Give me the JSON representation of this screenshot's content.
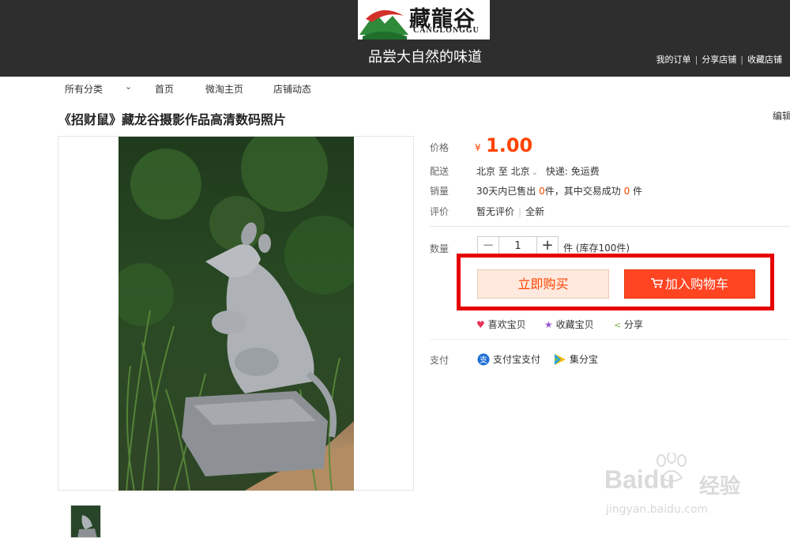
{
  "header": {
    "logo_cn": "藏龍谷",
    "logo_en": "CANGLONGGU",
    "slogan": "品尝大自然的味道",
    "links": [
      "我的订单",
      "分享店铺",
      "收藏店铺"
    ]
  },
  "nav": {
    "items": [
      "所有分类",
      "首页",
      "微淘主页",
      "店铺动态"
    ]
  },
  "product": {
    "title": "《招财鼠》藏龙谷摄影作品高清数码照片",
    "edit": "编辑"
  },
  "details": {
    "price_label": "价格",
    "currency": "¥",
    "price": "1.00",
    "ship_label": "配送",
    "ship_from": "北京 至",
    "ship_to": "北京",
    "express": "快递: 免运费",
    "sales_label": "销量",
    "sales_a": "30天内已售出",
    "sales_count": "0",
    "sales_b": "件，其中交易成功",
    "success_count": "0",
    "sales_c": "件",
    "review_label": "评价",
    "review_text": "暂无评价",
    "condition": "全新",
    "qty_label": "数量",
    "qty_value": "1",
    "minus": "−",
    "plus": "+",
    "stock": "件 (库存100件)",
    "buy_now": "立即购买",
    "add_cart": "加入购物车",
    "like": "喜欢宝贝",
    "favorite": "收藏宝贝",
    "share": "分享",
    "pay_label": "支付",
    "alipay": "支付宝支付",
    "jifenbao": "集分宝"
  },
  "watermark": {
    "brand": "Baidu",
    "cn": "经验",
    "url": "jingyan.baidu.com"
  },
  "colors": {
    "accent": "#ff4400",
    "highlight_box": "#e60000",
    "header_bg": "#2e2e2e"
  },
  "icons": [
    "cart-icon",
    "heart-icon",
    "star-icon",
    "share-icon",
    "alipay-icon",
    "jifenbao-icon",
    "chevron-down-icon"
  ]
}
